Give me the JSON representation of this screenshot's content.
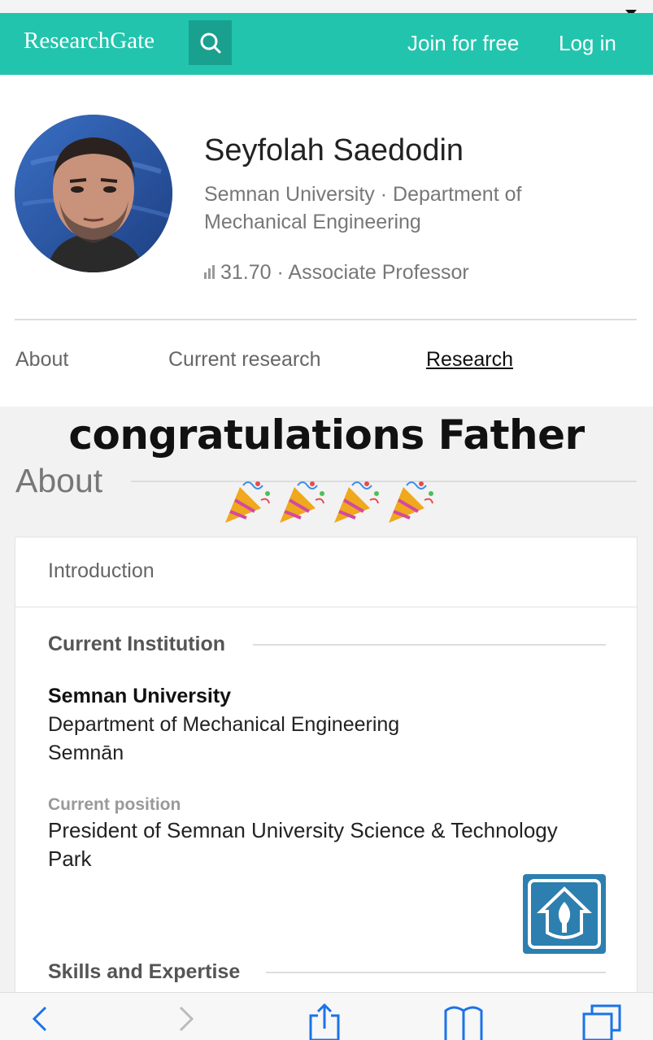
{
  "header": {
    "brand": "ResearchGate",
    "join_label": "Join for free",
    "login_label": "Log in",
    "accent": "#22c4ad"
  },
  "profile": {
    "name": "Seyfolah Saedodin",
    "affiliation": "Semnan University · Department of Mechanical Engineering",
    "score": "31.70",
    "score_separator": "·",
    "title": "Associate Professor"
  },
  "tabs": [
    {
      "label": "About",
      "active": false
    },
    {
      "label": "Current research",
      "active": false
    },
    {
      "label": "Research",
      "active": true
    }
  ],
  "overlay": {
    "caption": "congratulations Father",
    "emoji": "party-popper"
  },
  "about": {
    "heading": "About",
    "card_title": "Introduction",
    "current_institution_heading": "Current Institution",
    "institution_name": "Semnan University",
    "department": "Department of Mechanical Engineering",
    "city": "Semnān",
    "position_label": "Current position",
    "position_value": "President of Semnan University Science & Technology Park",
    "skills_heading": "Skills and Expertise"
  },
  "browser_toolbar": {
    "icons": [
      "back-icon",
      "forward-icon",
      "share-icon",
      "bookmarks-icon",
      "tabs-icon"
    ]
  }
}
